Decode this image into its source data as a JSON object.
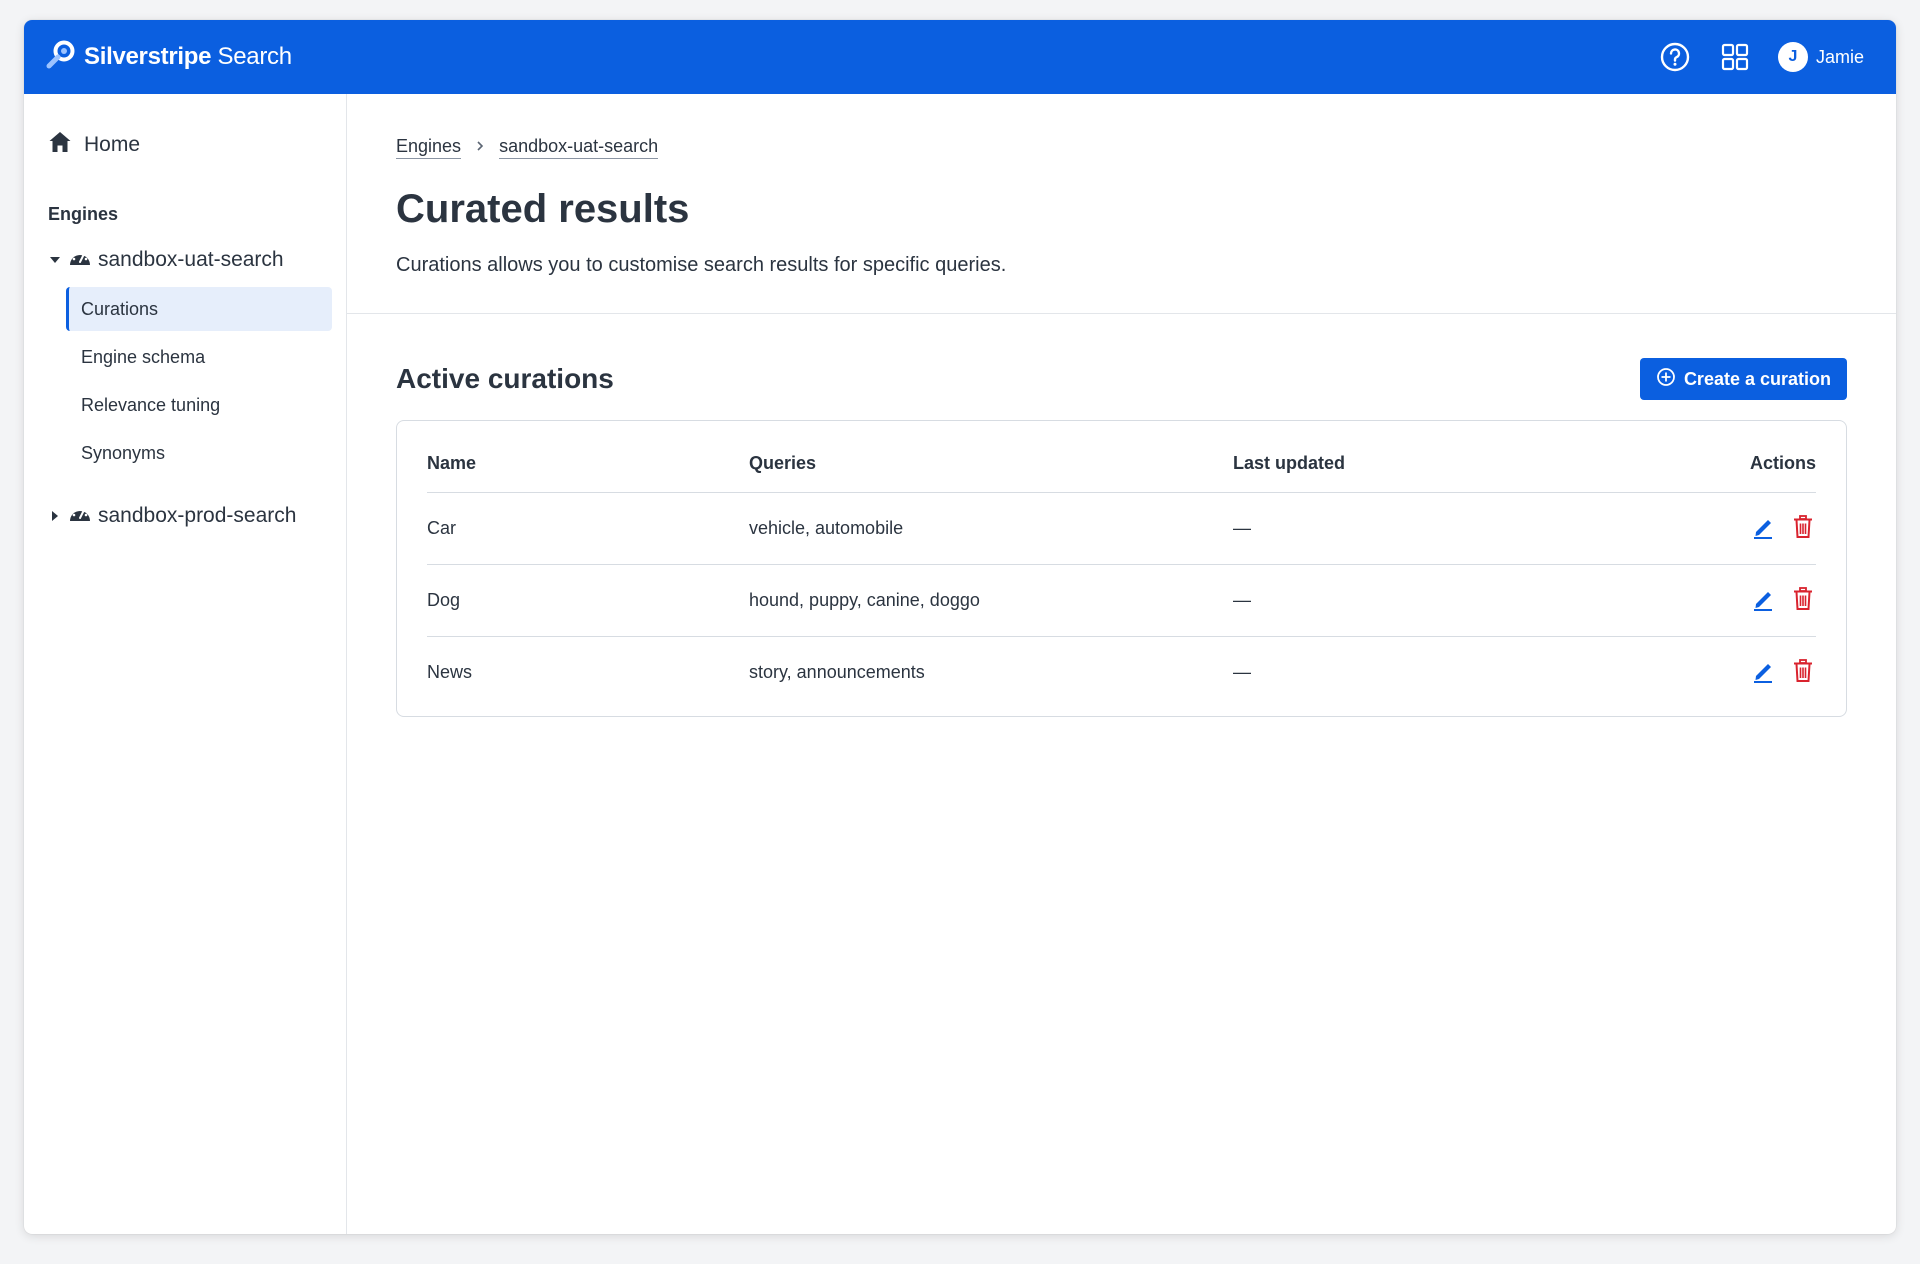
{
  "app": {
    "brand_bold": "Silverstripe",
    "brand_light": "Search",
    "user_initial": "J",
    "user_name": "Jamie"
  },
  "sidebar": {
    "home_label": "Home",
    "section_label": "Engines",
    "engines": [
      {
        "label": "sandbox-uat-search",
        "expanded": true,
        "items": [
          {
            "label": "Curations",
            "active": true
          },
          {
            "label": "Engine schema",
            "active": false
          },
          {
            "label": "Relevance tuning",
            "active": false
          },
          {
            "label": "Synonyms",
            "active": false
          }
        ]
      },
      {
        "label": "sandbox-prod-search",
        "expanded": false
      }
    ]
  },
  "breadcrumb": [
    "Engines",
    "sandbox-uat-search"
  ],
  "page": {
    "title": "Curated results",
    "description": "Curations allows you to customise search results for specific queries."
  },
  "curations": {
    "title": "Active curations",
    "create_label": "Create a curation",
    "columns": [
      "Name",
      "Queries",
      "Last updated",
      "Actions"
    ],
    "rows": [
      {
        "name": "Car",
        "queries": "vehicle, automobile",
        "last_updated": "—"
      },
      {
        "name": "Dog",
        "queries": "hound, puppy, canine, doggo",
        "last_updated": "—"
      },
      {
        "name": "News",
        "queries": "story, announcements",
        "last_updated": "—"
      }
    ]
  },
  "colors": {
    "brand_blue": "#0b5fe0",
    "danger_red": "#d9232e",
    "active_bg": "#e6eefb"
  },
  "icons": {
    "logo": "search-magnifier-logo-icon",
    "help": "help-circle-icon",
    "apps": "app-grid-icon",
    "home": "home-icon",
    "engine": "speedometer-icon",
    "edit": "pencil-icon",
    "delete": "trash-icon",
    "create": "plus-circle-icon"
  }
}
